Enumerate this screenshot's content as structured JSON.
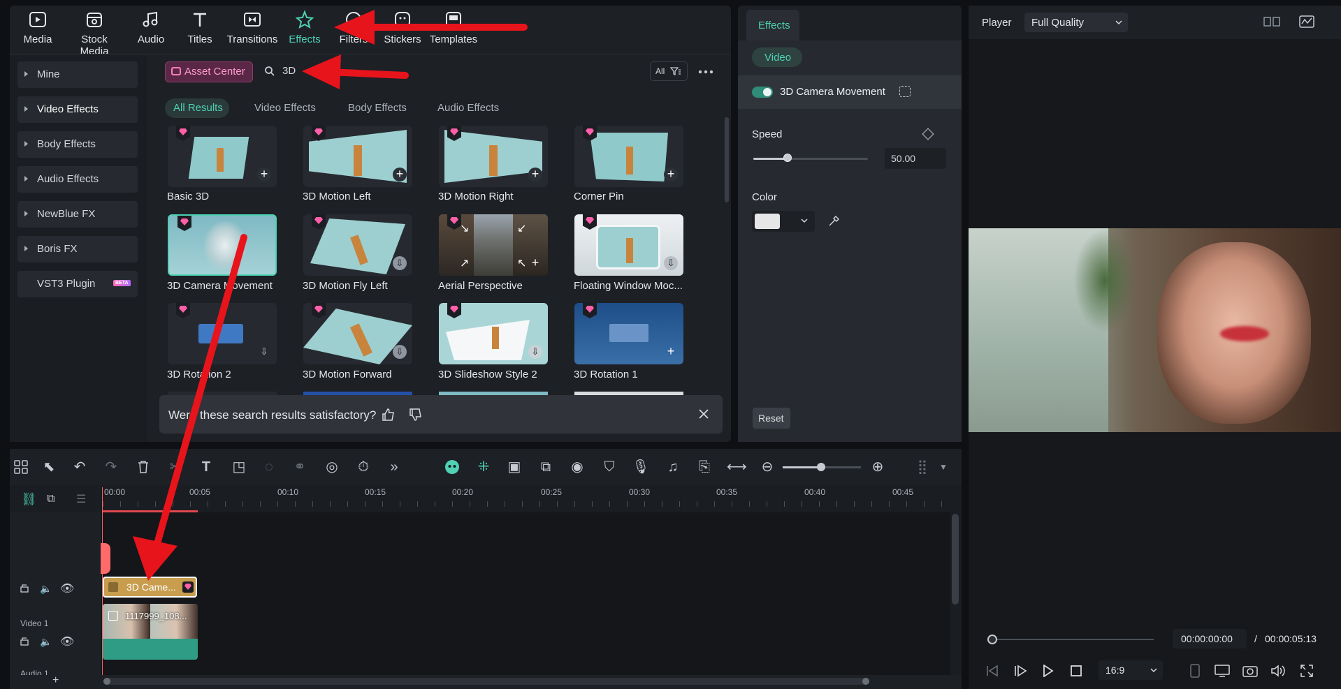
{
  "toolbar": {
    "items": [
      {
        "label": "Media",
        "icon": "media-icon"
      },
      {
        "label": "Stock Media",
        "icon": "stock-media-icon"
      },
      {
        "label": "Audio",
        "icon": "audio-icon"
      },
      {
        "label": "Titles",
        "icon": "titles-icon"
      },
      {
        "label": "Transitions",
        "icon": "transitions-icon"
      },
      {
        "label": "Effects",
        "icon": "effects-icon",
        "active": true
      },
      {
        "label": "Filters",
        "icon": "filters-icon"
      },
      {
        "label": "Stickers",
        "icon": "stickers-icon"
      },
      {
        "label": "Templates",
        "icon": "templates-icon"
      }
    ]
  },
  "sidebar": {
    "items": [
      {
        "label": "Mine"
      },
      {
        "label": "Video Effects"
      },
      {
        "label": "Body Effects"
      },
      {
        "label": "Audio Effects"
      },
      {
        "label": "NewBlue FX"
      },
      {
        "label": "Boris FX"
      },
      {
        "label": "VST3 Plugin",
        "badge": "BETA"
      }
    ]
  },
  "browser": {
    "asset_center": "Asset Center",
    "search_value": "3D",
    "filter_label": "All",
    "tabs": [
      "All Results",
      "Video Effects",
      "Body Effects",
      "Audio Effects"
    ],
    "effects": [
      {
        "label": "Basic 3D",
        "action": "add"
      },
      {
        "label": "3D Motion Left",
        "action": "add"
      },
      {
        "label": "3D Motion Right",
        "action": "add"
      },
      {
        "label": "Corner Pin",
        "action": "add"
      },
      {
        "label": "3D Camera Movement",
        "action": "none"
      },
      {
        "label": "3D Motion Fly Left",
        "action": "download"
      },
      {
        "label": "Aerial Perspective",
        "action": "add"
      },
      {
        "label": "Floating Window Moc...",
        "action": "download"
      },
      {
        "label": "3D Rotation 2",
        "action": "download"
      },
      {
        "label": "3D Motion Forward",
        "action": "download"
      },
      {
        "label": "3D Slideshow Style 2",
        "action": "download"
      },
      {
        "label": "3D Rotation 1",
        "action": "add"
      }
    ],
    "feedback": "Were these search results satisfactory?"
  },
  "properties": {
    "tab": "Effects",
    "subtab": "Video",
    "effect_name": "3D Camera Movement",
    "speed_label": "Speed",
    "speed_value": "50.00",
    "speed_level": 0.5,
    "color_label": "Color",
    "color_value": "#e6e6e6",
    "reset_label": "Reset"
  },
  "player": {
    "title": "Player",
    "quality": "Full Quality",
    "current_time": "00:00:00:00",
    "separator": "/",
    "total_time": "00:00:05:13",
    "ratio": "16:9"
  },
  "timeline": {
    "ruler": [
      "00:00",
      "00:05",
      "00:10",
      "00:15",
      "00:20",
      "00:25",
      "00:30",
      "00:35",
      "00:40",
      "00:45"
    ],
    "effect_clip": "3D Came...",
    "video_clip": "1117999_108...",
    "track_video": "Video 1",
    "track_audio": "Audio 1",
    "add_track": "+"
  },
  "colors": {
    "accent": "#4fd1b4",
    "arrow": "#e8141b",
    "clip_effect": "#c89d4e",
    "clip_video": "#2f9d85"
  }
}
